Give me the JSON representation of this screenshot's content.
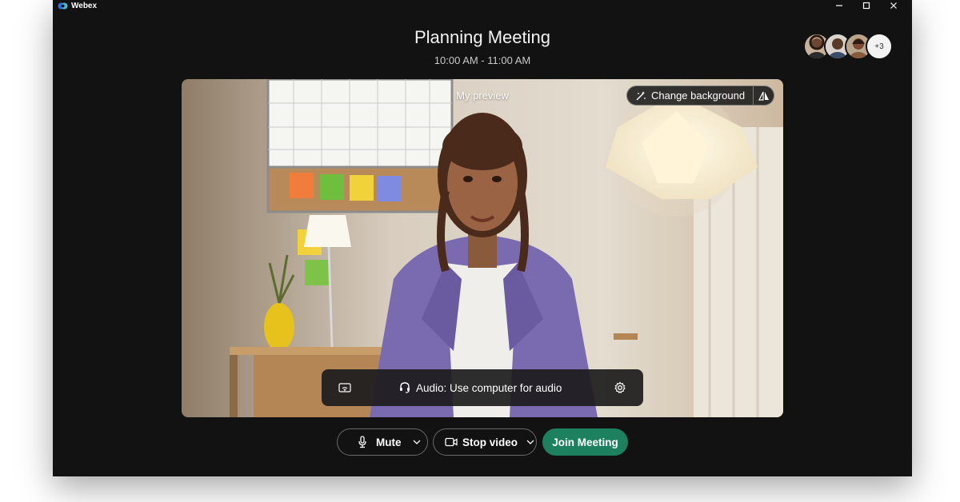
{
  "app": {
    "name": "Webex",
    "brand_color": "#2d6de5"
  },
  "window_controls": [
    "minimize-icon",
    "maximize-icon",
    "close-icon"
  ],
  "meeting": {
    "title": "Planning Meeting",
    "time": "10:00 AM - 11:00 AM"
  },
  "participants": {
    "avatars": [
      "participant-1",
      "participant-2",
      "participant-3"
    ],
    "more_count": "+3"
  },
  "preview": {
    "label": "My preview",
    "change_background_label": "Change background",
    "mirror_icon": "mirror-icon"
  },
  "audio_bar": {
    "proximity_icon": "proximity-share-icon",
    "audio_label": "Audio: Use computer for audio",
    "headset_icon": "headset-icon",
    "settings_icon": "gear-icon"
  },
  "controls": {
    "mute_label": "Mute",
    "stop_video_label": "Stop video",
    "join_label": "Join Meeting",
    "join_color": "#1d8160"
  }
}
